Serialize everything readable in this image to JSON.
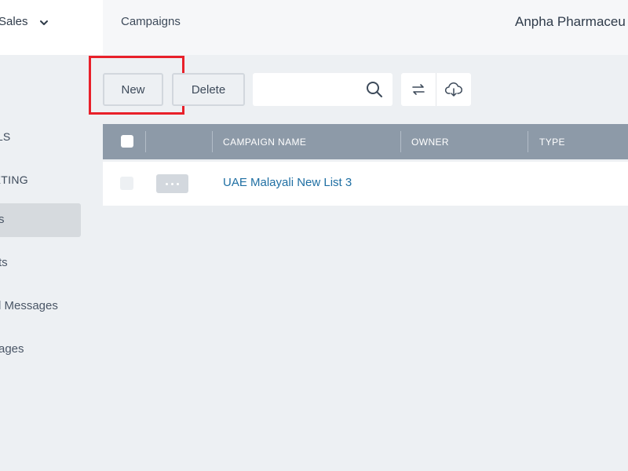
{
  "header": {
    "module_label": "Sales",
    "title": "Campaigns",
    "company": "Anpha Pharmaceu"
  },
  "sidebar": {
    "groups": [
      {
        "label": "AILS"
      },
      {
        "label": "KETING"
      }
    ],
    "items": [
      {
        "label": "s",
        "active": true
      },
      {
        "label": "ts"
      },
      {
        "label": "l Messages"
      },
      {
        "label": "ages"
      }
    ]
  },
  "toolbar": {
    "new_label": "New",
    "delete_label": "Delete",
    "search_value": "",
    "search_placeholder": "",
    "icons": [
      "sync-icon",
      "cloud-download-icon"
    ]
  },
  "table": {
    "columns": [
      "",
      "",
      "CAMPAIGN NAME",
      "OWNER",
      "TYPE"
    ],
    "rows": [
      {
        "campaign_name": "UAE Malayali New List 3",
        "owner": "",
        "type": ""
      }
    ]
  },
  "colors": {
    "accent_link": "#1f6fa3",
    "table_header": "#8d9aa8",
    "highlight_box": "#e8202a",
    "background": "#edf0f3"
  }
}
